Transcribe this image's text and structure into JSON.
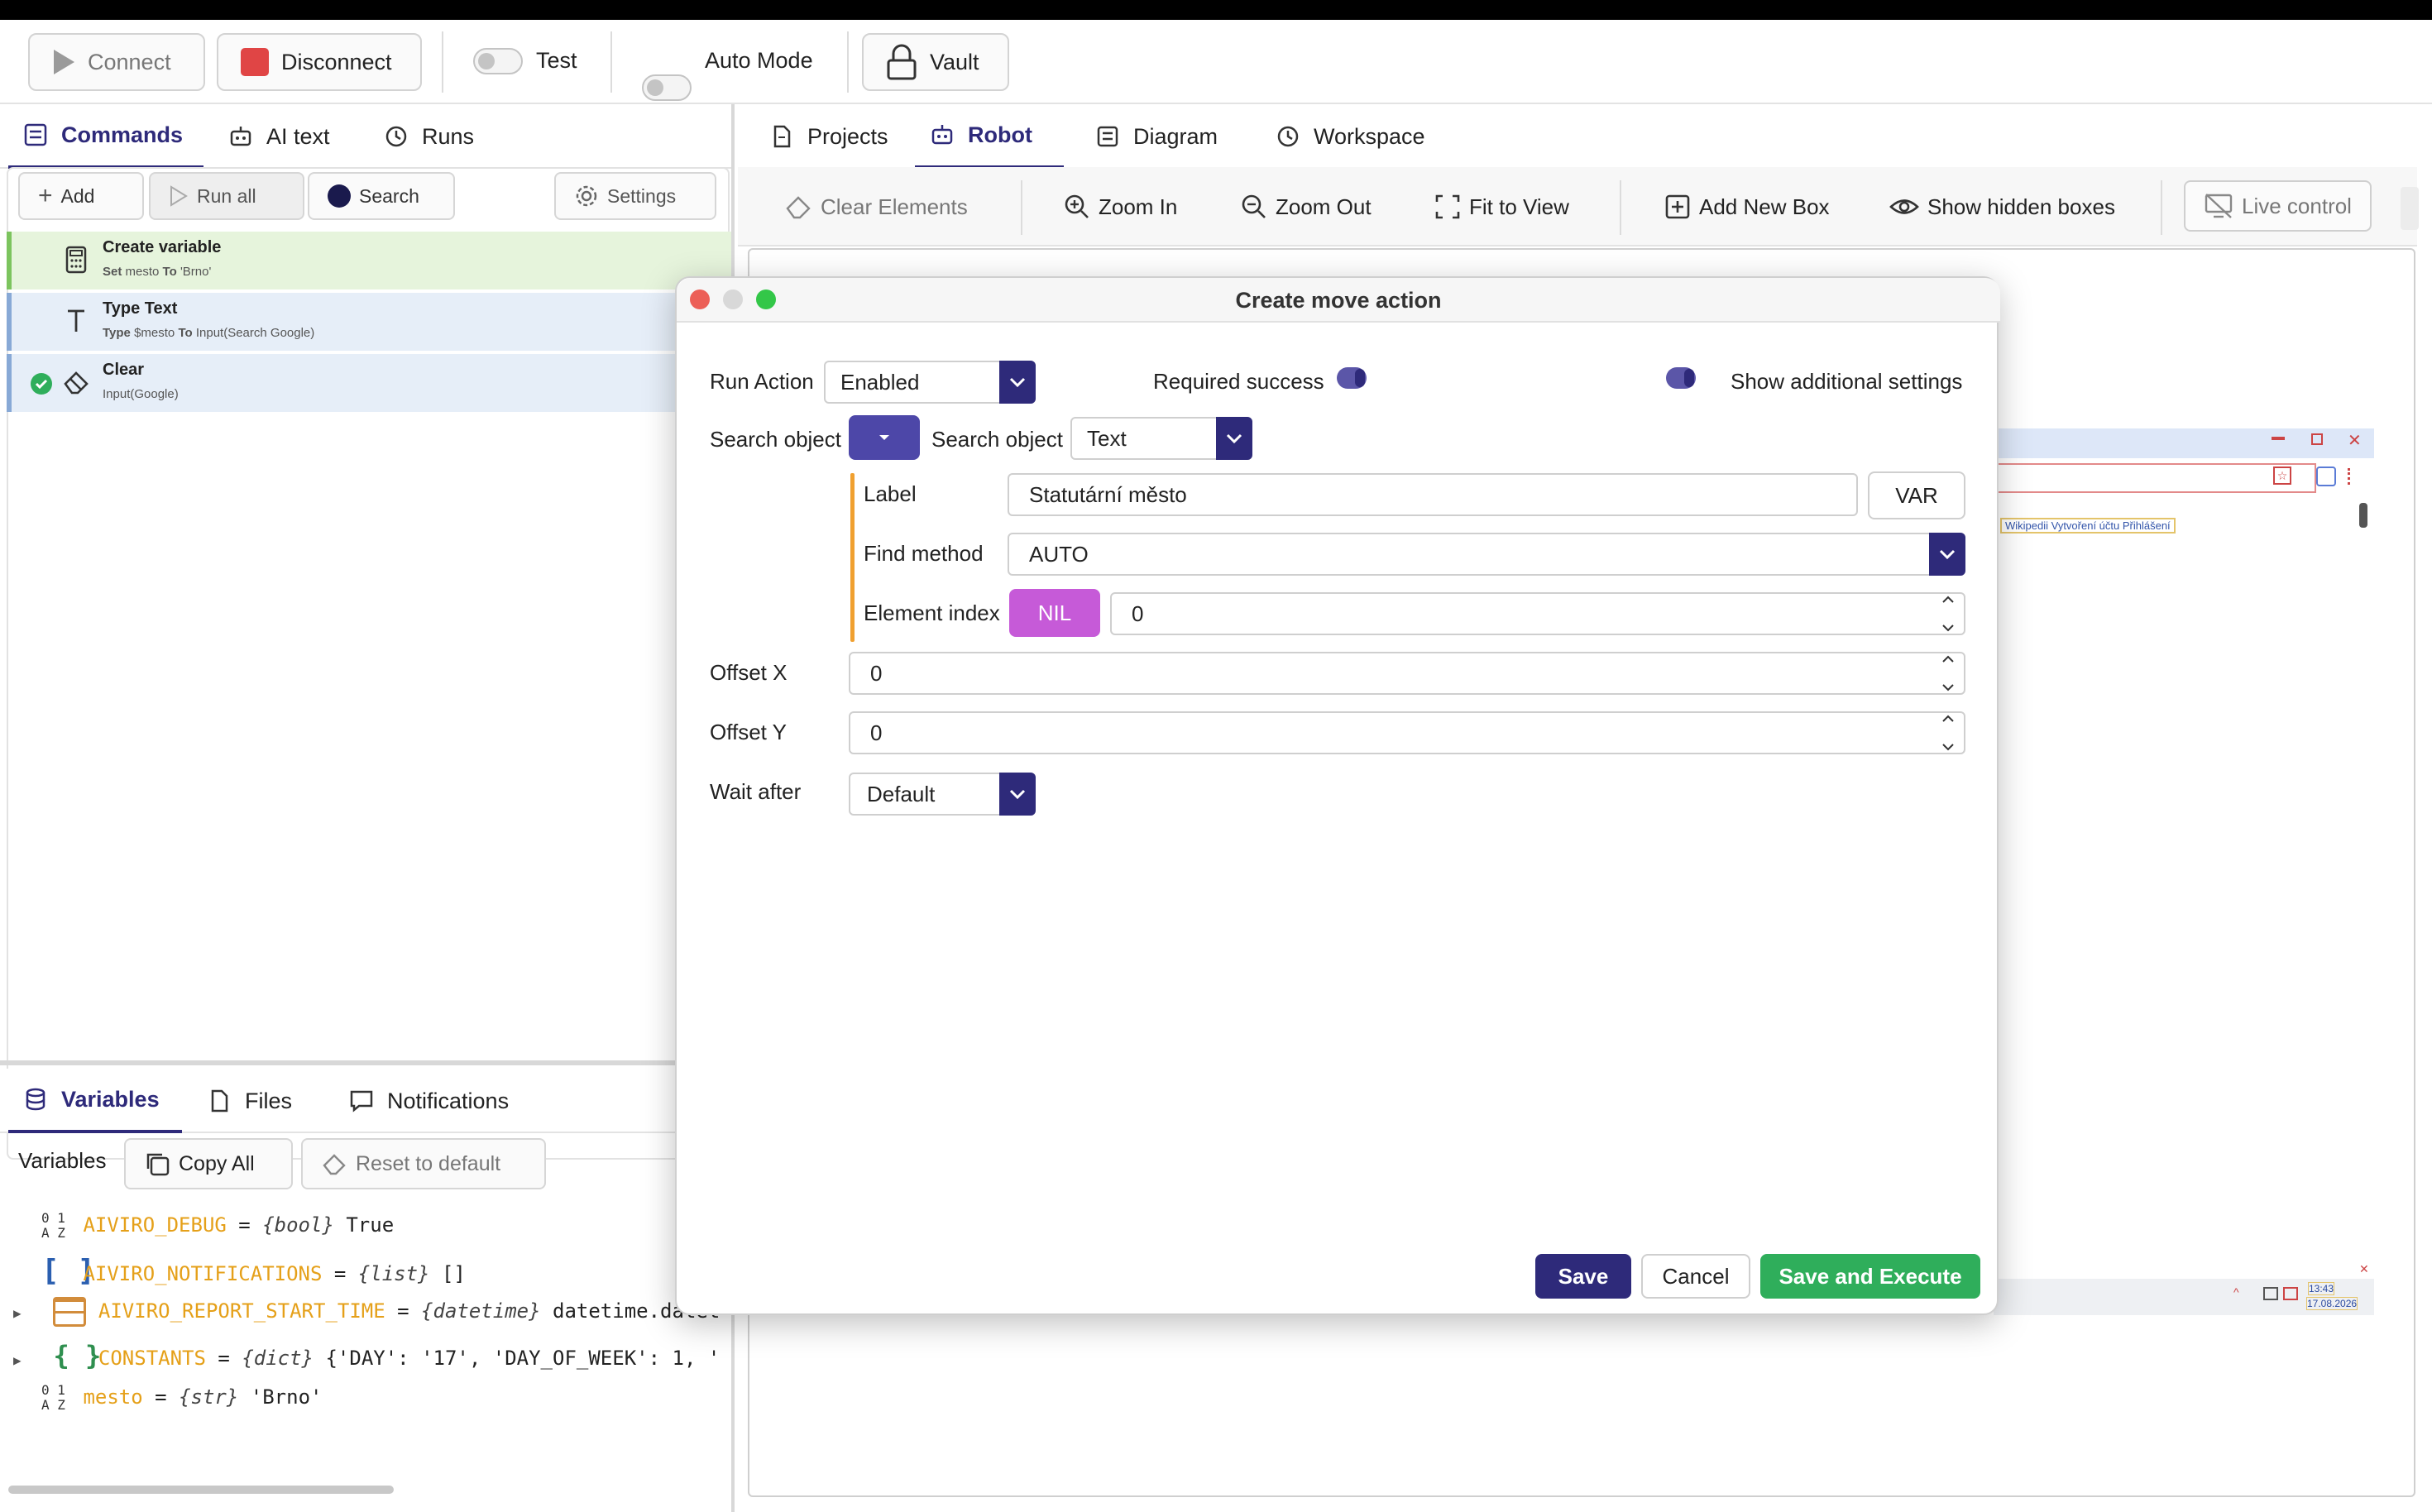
{
  "toolbar": {
    "connect": "Connect",
    "disconnect": "Disconnect",
    "test": "Test",
    "auto_mode": "Auto Mode",
    "vault": "Vault"
  },
  "left_tabs": [
    "Commands",
    "AI text",
    "Runs"
  ],
  "commands_toolbar": {
    "add": "Add",
    "run_all": "Run all",
    "search": "Search",
    "settings": "Settings"
  },
  "commands": [
    {
      "title": "Create variable",
      "sub_kw1": "Set",
      "sub_a": "mesto",
      "sub_kw2": "To",
      "sub_b": "'Brno'",
      "color": "#e6f4dc",
      "border": "#7cc45e"
    },
    {
      "title": "Type Text",
      "sub_kw1": "Type",
      "sub_a": "$mesto",
      "sub_kw2": "To",
      "sub_b": "Input(Search Google)",
      "color": "#e6eef8",
      "border": "#88a9d6"
    },
    {
      "title": "Clear",
      "sub_kw1": "",
      "sub_a": "Input(Google)",
      "sub_kw2": "",
      "sub_b": "",
      "color": "#e6eef8",
      "border": "#88a9d6"
    }
  ],
  "bottom_tabs": [
    "Variables",
    "Files",
    "Notifications"
  ],
  "variables_toolbar": {
    "label": "Variables",
    "copy_all": "Copy All",
    "reset": "Reset to default"
  },
  "variables": [
    {
      "name": "AIVIRO_DEBUG",
      "type": "{bool}",
      "value": "True"
    },
    {
      "name": "AIVIRO_NOTIFICATIONS",
      "type": "{list}",
      "value": "[]"
    },
    {
      "name": "AIVIRO_REPORT_START_TIME",
      "type": "{datetime}",
      "value": "datetime.datet"
    },
    {
      "name": "CONSTANTS",
      "type": "{dict}",
      "value": "{'DAY': '17', 'DAY_OF_WEEK': 1, '"
    },
    {
      "name": "mesto",
      "type": "{str}",
      "value": "'Brno'"
    }
  ],
  "right_tabs": [
    "Projects",
    "Robot",
    "Diagram",
    "Workspace"
  ],
  "robot_toolbar": {
    "clear_elements": "Clear Elements",
    "zoom_in": "Zoom In",
    "zoom_out": "Zoom Out",
    "fit_to_view": "Fit to View",
    "add_new_box": "Add New Box",
    "show_hidden_boxes": "Show hidden boxes",
    "live_control": "Live control"
  },
  "canvas": {
    "links": "Wikipedii  Vytvoření účtu  Přihlášení",
    "clock_time": "13:43",
    "clock_date": "17.08.2026"
  },
  "dialog": {
    "title": "Create move action",
    "run_action_label": "Run Action",
    "run_action_value": "Enabled",
    "required_success_label": "Required success",
    "show_additional_label": "Show additional settings",
    "search_object_label": "Search object",
    "search_object_label2": "Search object",
    "search_object_type": "Text",
    "label_label": "Label",
    "label_value": "Statutární město",
    "var_button": "VAR",
    "find_method_label": "Find method",
    "find_method_value": "AUTO",
    "element_index_label": "Element index",
    "nil_button": "NIL",
    "element_index_value": "0",
    "offset_x_label": "Offset X",
    "offset_x_value": "0",
    "offset_y_label": "Offset Y",
    "offset_y_value": "0",
    "wait_after_label": "Wait after",
    "wait_after_value": "Default",
    "save": "Save",
    "cancel": "Cancel",
    "save_execute": "Save and Execute"
  },
  "colors": {
    "accent": "#2e2a7a",
    "save_execute": "#2fae5b",
    "nil": "#c65ad8",
    "variable_name": "#e5a019"
  }
}
